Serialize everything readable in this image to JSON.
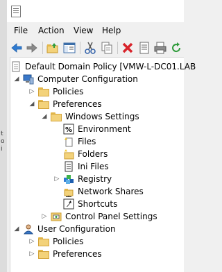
{
  "left_fragments": [
    "t",
    "o",
    "i"
  ],
  "menu": [
    "File",
    "Action",
    "View",
    "Help"
  ],
  "toolbar_icons": [
    "back-arrow-icon",
    "forward-arrow-icon",
    "up-folder-icon",
    "show-hide-tree-icon",
    "cut-icon",
    "copy-icon",
    "delete-icon",
    "properties-icon",
    "print-icon",
    "refresh-icon"
  ],
  "tree": {
    "root": "Default Domain Policy [VMW-L-DC01.LAB",
    "computer_configuration": "Computer Configuration",
    "policies": "Policies",
    "preferences": "Preferences",
    "windows_settings": "Windows Settings",
    "environment": "Environment",
    "files": "Files",
    "folders": "Folders",
    "ini_files": "Ini Files",
    "registry": "Registry",
    "network_shares": "Network Shares",
    "shortcuts": "Shortcuts",
    "control_panel_settings": "Control Panel Settings",
    "user_configuration": "User Configuration",
    "user_policies": "Policies",
    "user_preferences": "Preferences"
  }
}
